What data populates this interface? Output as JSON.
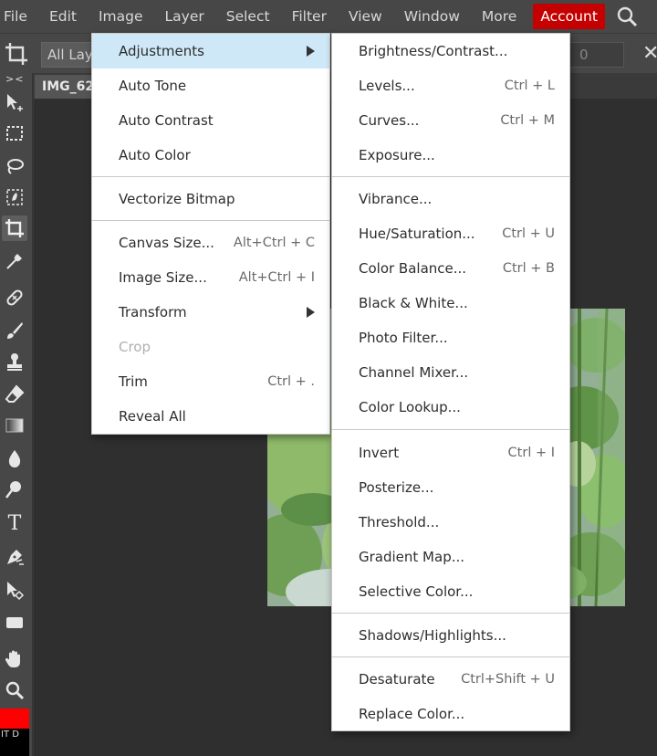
{
  "menubar": {
    "items": [
      "File",
      "Edit",
      "Image",
      "Layer",
      "Select",
      "Filter",
      "View",
      "Window",
      "More"
    ],
    "account": "Account",
    "search_icon": "search-icon"
  },
  "options_bar": {
    "layer_select": "All Layers",
    "value_field": "0",
    "close": "✕"
  },
  "toolbar": {
    "collapse": "><",
    "type_tool": "T",
    "bg_label": "IT D"
  },
  "doc_tab": {
    "title": "IMG_62"
  },
  "image_menu": {
    "items": [
      {
        "label": "Adjustments",
        "submenu": true,
        "highlighted": true
      },
      {
        "label": "Auto Tone"
      },
      {
        "label": "Auto Contrast"
      },
      {
        "label": "Auto Color"
      },
      {
        "label": "Vectorize Bitmap"
      },
      {
        "label": "Canvas Size...",
        "shortcut": "Alt+Ctrl + C"
      },
      {
        "label": "Image Size...",
        "shortcut": "Alt+Ctrl + I"
      },
      {
        "label": "Transform",
        "submenu": true
      },
      {
        "label": "Crop",
        "disabled": true
      },
      {
        "label": "Trim",
        "shortcut": "Ctrl + ."
      },
      {
        "label": "Reveal All"
      }
    ]
  },
  "adjust_menu": {
    "items": [
      {
        "label": "Brightness/Contrast..."
      },
      {
        "label": "Levels...",
        "shortcut": "Ctrl + L"
      },
      {
        "label": "Curves...",
        "shortcut": "Ctrl + M"
      },
      {
        "label": "Exposure..."
      },
      {
        "label": "Vibrance..."
      },
      {
        "label": "Hue/Saturation...",
        "shortcut": "Ctrl + U"
      },
      {
        "label": "Color Balance...",
        "shortcut": "Ctrl + B"
      },
      {
        "label": "Black & White..."
      },
      {
        "label": "Photo Filter..."
      },
      {
        "label": "Channel Mixer..."
      },
      {
        "label": "Color Lookup..."
      },
      {
        "label": "Invert",
        "shortcut": "Ctrl + I"
      },
      {
        "label": "Posterize..."
      },
      {
        "label": "Threshold..."
      },
      {
        "label": "Gradient Map..."
      },
      {
        "label": "Selective Color..."
      },
      {
        "label": "Shadows/Highlights..."
      },
      {
        "label": "Desaturate",
        "shortcut": "Ctrl+Shift + U"
      },
      {
        "label": "Replace Color..."
      }
    ]
  },
  "colors": {
    "account": "#c40000",
    "foreground": "#ff0000",
    "background": "#000000",
    "menu_highlight": "#cfe8f8"
  }
}
